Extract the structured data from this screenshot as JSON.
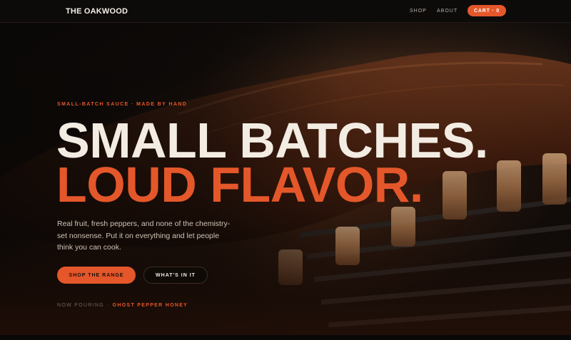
{
  "brand": {
    "name": "THE OAKWOOD"
  },
  "nav": {
    "links": [
      "SHOP",
      "ABOUT"
    ],
    "cart_label": "CART · 0"
  },
  "hero": {
    "eyebrow": "SMALL-BATCH SAUCE · MADE BY HAND",
    "headline_line1": "SMALL BATCHES.",
    "headline_line2": "LOUD FLAVOR.",
    "body": "Real fruit, fresh peppers, and none of the chemistry-set nonsense. Put it on everything and let people think you can cook.",
    "primary_cta": "SHOP THE RANGE",
    "secondary_cta": "WHAT'S IN IT",
    "now_pouring_label": "NOW POURING",
    "now_pouring_separator": "·",
    "now_pouring_value": "GHOST PEPPER HONEY"
  },
  "colors": {
    "accent": "#e4572a",
    "headline_light": "#f3ece2",
    "background": "#0b0908"
  },
  "icons": {
    "hero_image": "barbecue-ribs-on-grill"
  }
}
